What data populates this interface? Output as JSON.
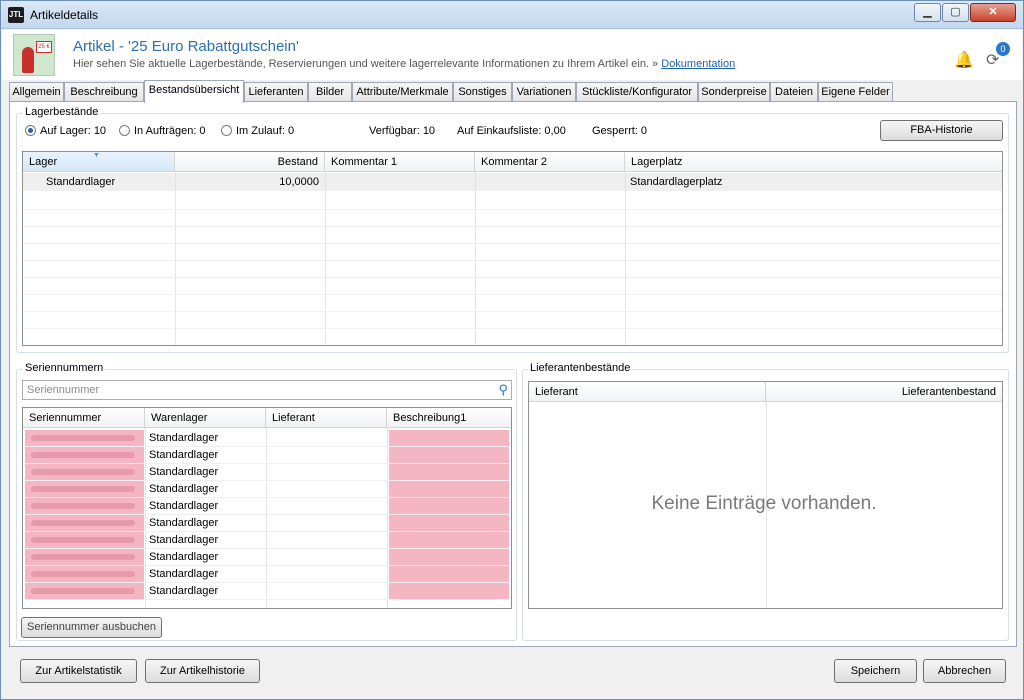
{
  "window": {
    "title": "Artikeldetails",
    "app_icon": "JTL"
  },
  "header": {
    "title": "Artikel - '25 Euro Rabattgutschein'",
    "description": "Hier sehen Sie aktuelle Lagerbestände, Reservierungen und weitere lagerrelevante Informationen zu Ihrem Artikel ein. »",
    "doc_link": "Dokumentation",
    "sync_badge": "0",
    "product_badge": "25 €"
  },
  "tabs": [
    "Allgemein",
    "Beschreibung",
    "Bestandsübersicht",
    "Lieferanten",
    "Bilder",
    "Attribute/Merkmale",
    "Sonstiges",
    "Variationen",
    "Stückliste/Konfigurator",
    "Sonderpreise",
    "Dateien",
    "Eigene Felder"
  ],
  "active_tab": "Bestandsübersicht",
  "lager": {
    "group_label": "Lagerbestände",
    "radios": [
      {
        "label": "Auf Lager: 10",
        "selected": true
      },
      {
        "label": "In Aufträgen: 0",
        "selected": false
      },
      {
        "label": "Im Zulauf: 0",
        "selected": false
      }
    ],
    "stats": {
      "verfuegbar": "Verfügbar: 10",
      "einkaufsliste": "Auf Einkaufsliste: 0,00",
      "gesperrt": "Gesperrt: 0"
    },
    "fba_button": "FBA-Historie",
    "columns": [
      "Lager",
      "Bestand",
      "Kommentar 1",
      "Kommentar 2",
      "Lagerplatz"
    ],
    "rows": [
      {
        "lager": "Standardlager",
        "bestand": "10,0000",
        "kommentar1": "",
        "kommentar2": "",
        "lagerplatz": "Standardlagerplatz"
      }
    ]
  },
  "serial": {
    "group_label": "Seriennummern",
    "search_placeholder": "Seriennummer",
    "columns": [
      "Seriennummer",
      "Warenlager",
      "Lieferant",
      "Beschreibung1"
    ],
    "rows": [
      "Standardlager",
      "Standardlager",
      "Standardlager",
      "Standardlager",
      "Standardlager",
      "Standardlager",
      "Standardlager",
      "Standardlager",
      "Standardlager",
      "Standardlager"
    ],
    "book_button": "Seriennummer ausbuchen"
  },
  "supplier": {
    "group_label": "Lieferantenbestände",
    "columns": [
      "Lieferant",
      "Lieferantenbestand"
    ],
    "empty_text": "Keine Einträge vorhanden."
  },
  "footer": {
    "stats_button": "Zur Artikelstatistik",
    "history_button": "Zur Artikelhistorie",
    "save_button": "Speichern",
    "cancel_button": "Abbrechen"
  },
  "colors": {
    "title_blue": "#2c6fb5",
    "serial_highlight": "#f4b6c2",
    "badge_blue": "#2a78c8"
  }
}
